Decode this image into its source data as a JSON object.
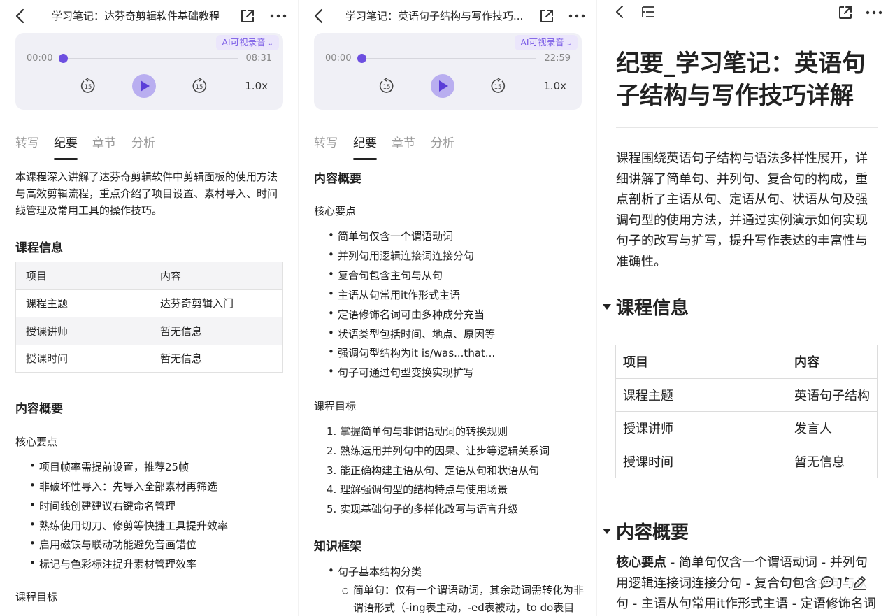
{
  "panel1": {
    "title": "学习笔记：达芬奇剪辑软件基础教程",
    "player": {
      "ai_tag": "AI可视录音",
      "time_start": "00:00",
      "time_end": "08:31",
      "skip_back": "15",
      "skip_fwd": "15",
      "speed": "1.0x",
      "progress": 0
    },
    "tabs": [
      "转写",
      "纪要",
      "章节",
      "分析"
    ],
    "summary": "本课程深入讲解了达芬奇剪辑软件中剪辑面板的使用方法与高效剪辑流程，重点介绍了项目设置、素材导入、时间线管理及常用工具的操作技巧。",
    "course_info_heading": "课程信息",
    "table": [
      [
        "项目",
        "内容"
      ],
      [
        "课程主题",
        "达芬奇剪辑入门"
      ],
      [
        "授课讲师",
        "暂无信息"
      ],
      [
        "授课时间",
        "暂无信息"
      ]
    ],
    "overview_heading": "内容概要",
    "key_points_heading": "核心要点",
    "key_points": [
      "项目帧率需提前设置，推荐25帧",
      "非破坏性导入：先导入全部素材再筛选",
      "时间线创建建议右键命名管理",
      "熟练使用切刀、修剪等快捷工具提升效率",
      "启用磁铁与联动功能避免音画错位",
      "标记与色彩标注提升素材管理效率"
    ],
    "goals_heading": "课程目标"
  },
  "panel2": {
    "title": "学习笔记：英语句子结构与写作技巧...",
    "player": {
      "ai_tag": "AI可视录音",
      "time_start": "00:00",
      "time_end": "22:59",
      "skip_back": "15",
      "skip_fwd": "15",
      "speed": "1.0x",
      "progress": 0
    },
    "tabs": [
      "转写",
      "纪要",
      "章节",
      "分析"
    ],
    "overview_heading": "内容概要",
    "key_points_heading": "核心要点",
    "key_points": [
      "简单句仅含一个谓语动词",
      "并列句用逻辑连接词连接分句",
      "复合句包含主句与从句",
      "主语从句常用it作形式主语",
      "定语修饰名词可由多种成分充当",
      "状语类型包括时间、地点、原因等",
      "强调句型结构为it is/was...that...",
      "句子可通过句型变换实现扩写"
    ],
    "goals_heading": "课程目标",
    "goals": [
      "掌握简单句与非谓语动词的转换规则",
      "熟练运用并列句中的因果、让步等逻辑关系词",
      "能正确构建主语从句、定语从句和状语从句",
      "理解强调句型的结构特点与使用场景",
      "实现基础句子的多样化改写与语言升级"
    ],
    "framework_heading": "知识框架",
    "framework_item": "句子基本结构分类",
    "framework_sub": "简单句：仅有一个谓语动词，其余动词需转化为非谓语形式（-ing表主动，-ed表被动，to do表目"
  },
  "panel3": {
    "title": "纪要_学习笔记：英语句子结构与写作技巧详解",
    "summary": "课程围绕英语句子结构与语法多样性展开，详细讲解了简单句、并列句、复合句的构成，重点剖析了主语从句、定语从句、状语从句及强调句型的使用方法，并通过实例演示如何实现句子的改写与扩写，提升写作表达的丰富性与准确性。",
    "course_info_heading": "课程信息",
    "table": [
      [
        "项目",
        "内容"
      ],
      [
        "课程主题",
        "英语句子结构"
      ],
      [
        "授课讲师",
        "发言人"
      ],
      [
        "授课时间",
        "暂无信息"
      ]
    ],
    "overview_heading": "内容概要",
    "body_bold": "核心要点",
    "body_text": " - 简单句仅含一个谓语动词 - 并列句用逻辑连接词连接分句 - 复合句包含主句与从句 - 主语从句常用it作形式主语 - 定语修饰名词"
  },
  "colors": {
    "accent": "#6d4fe0",
    "player_bg": "#f0f0f6",
    "tag_bg": "#ebe6fb",
    "muted": "#999999"
  },
  "icons": [
    "back-icon",
    "share-icon",
    "more-icon",
    "rewind-15-icon",
    "forward-15-icon",
    "play-icon",
    "outline-icon",
    "comment-icon",
    "edit-icon"
  ]
}
